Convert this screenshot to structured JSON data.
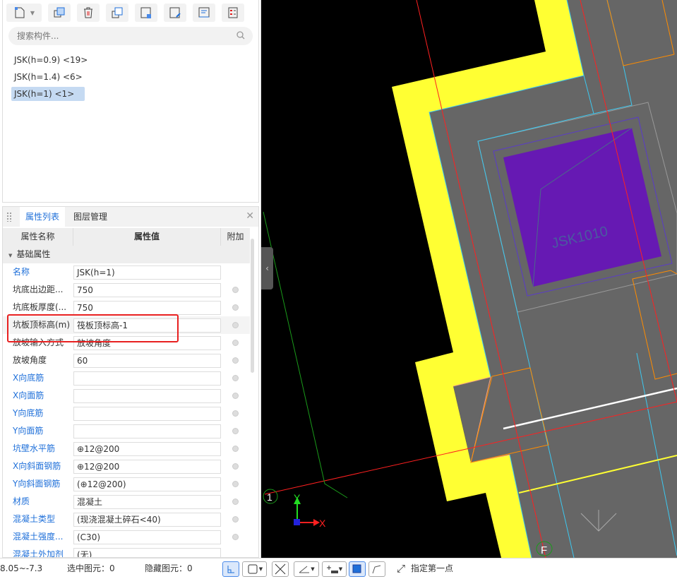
{
  "toolbar": {
    "icons": [
      "new-component-icon",
      "copy-icon",
      "delete-icon",
      "layer-copy-icon",
      "save-template-icon",
      "edit-template-icon",
      "properties-icon",
      "checklist-icon"
    ]
  },
  "search": {
    "placeholder": "搜索构件..."
  },
  "components": [
    {
      "label": "JSK(h=0.9)  <19>",
      "selected": false
    },
    {
      "label": "JSK(h=1.4)  <6>",
      "selected": false
    },
    {
      "label": "JSK(h=1)  <1>",
      "selected": true
    }
  ],
  "panel": {
    "tabs": [
      "属性列表",
      "图层管理"
    ],
    "active_tab": 0,
    "columns": [
      "属性名称",
      "属性值",
      "附加"
    ],
    "group": "基础属性",
    "rows": [
      {
        "name": "名称",
        "value": "JSK(h=1)",
        "blue": true,
        "dot": false
      },
      {
        "name": "坑底出边距...",
        "value": "750",
        "blue": false,
        "dot": true
      },
      {
        "name": "坑底板厚度(...",
        "value": "750",
        "blue": false,
        "dot": true
      },
      {
        "name": "坑板顶标高(m)",
        "value": "筏板顶标高-1",
        "blue": false,
        "dot": true
      },
      {
        "name": "放坡输入方式",
        "value": "放坡角度",
        "blue": false,
        "dot": true
      },
      {
        "name": "放坡角度",
        "value": "60",
        "blue": false,
        "dot": true
      },
      {
        "name": "X向底筋",
        "value": "",
        "blue": true,
        "dot": true
      },
      {
        "name": "X向面筋",
        "value": "",
        "blue": true,
        "dot": true
      },
      {
        "name": "Y向底筋",
        "value": "",
        "blue": true,
        "dot": true
      },
      {
        "name": "Y向面筋",
        "value": "",
        "blue": true,
        "dot": true
      },
      {
        "name": "坑壁水平筋",
        "value": "⊕12@200",
        "blue": true,
        "dot": true
      },
      {
        "name": "X向斜面钢筋",
        "value": "⊕12@200",
        "blue": true,
        "dot": true
      },
      {
        "name": "Y向斜面钢筋",
        "value": "(⊕12@200)",
        "blue": true,
        "dot": true
      },
      {
        "name": "材质",
        "value": "混凝土",
        "blue": true,
        "dot": true
      },
      {
        "name": "混凝土类型",
        "value": "(现浇混凝土碎石<40)",
        "blue": true,
        "dot": true
      },
      {
        "name": "混凝土强度...",
        "value": "(C30)",
        "blue": true,
        "dot": true
      },
      {
        "name": "混凝土外加剂",
        "value": "(无)",
        "blue": true,
        "dot": false
      }
    ]
  },
  "cad": {
    "pit_label": "JSK1010",
    "axis_1": "1",
    "axis_f": "F",
    "x_axis": "X",
    "y_axis": "Y"
  },
  "status": {
    "coords": "8.05~-7.3",
    "selected": "选中图元：0",
    "hidden": "隐藏图元：0",
    "prompt": "指定第一点"
  },
  "colors": {
    "accent": "#1e6fd9",
    "highlight_box": "#e82020",
    "pit": "#6619b3",
    "wall": "#ffff33"
  }
}
